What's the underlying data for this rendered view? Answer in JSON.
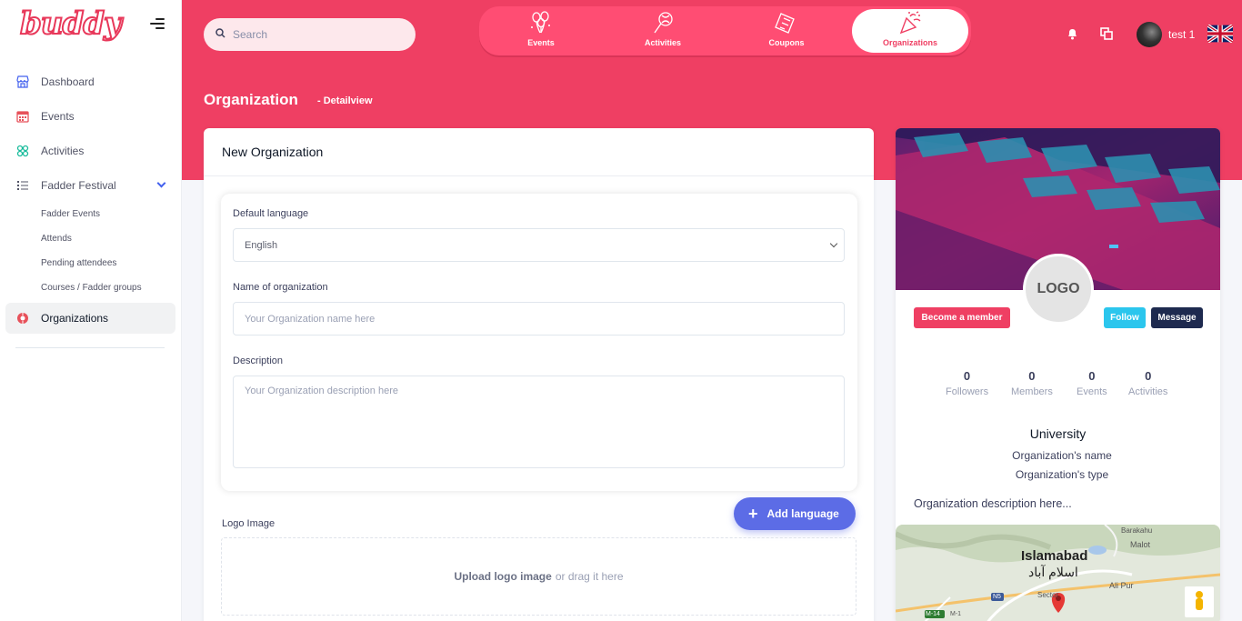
{
  "app": {
    "logo_text": "buddy"
  },
  "sidebar": {
    "items": [
      {
        "label": "Dashboard",
        "icon": "store-icon"
      },
      {
        "label": "Events",
        "icon": "calendar-icon"
      },
      {
        "label": "Activities",
        "icon": "activities-icon"
      },
      {
        "label": "Fadder Festival",
        "icon": "list-icon"
      },
      {
        "label": "Organizations",
        "icon": "organization-icon"
      }
    ],
    "subitems": [
      "Fadder Events",
      "Attends",
      "Pending attendees",
      "Courses / Fadder groups"
    ]
  },
  "header": {
    "search_placeholder": "Search",
    "tabs": [
      {
        "label": "Events",
        "icon": "balloons-icon"
      },
      {
        "label": "Activities",
        "icon": "lollipop-icon"
      },
      {
        "label": "Coupons",
        "icon": "ticket-icon"
      },
      {
        "label": "Organizations",
        "icon": "party-popper-icon",
        "active": true
      }
    ],
    "user_name": "test 1",
    "language_flag": "uk-flag-icon"
  },
  "page": {
    "title": "Organization",
    "breadcrumb": "- Detailview"
  },
  "form": {
    "card_title": "New Organization",
    "default_language_label": "Default language",
    "default_language_value": "English",
    "name_label": "Name of organization",
    "name_placeholder": "Your Organization name here",
    "description_label": "Description",
    "description_placeholder": "Your Organization description here",
    "add_language_label": "Add language",
    "logo_image_label": "Logo Image",
    "upload_bold": "Upload logo image",
    "upload_rest": "or drag it here"
  },
  "profile": {
    "logo_text": "LOGO",
    "become_member_label": "Become a member",
    "follow_label": "Follow",
    "message_label": "Message",
    "stats": [
      {
        "value": "0",
        "caption": "Followers"
      },
      {
        "value": "0",
        "caption": "Members"
      },
      {
        "value": "0",
        "caption": "Events"
      },
      {
        "value": "0",
        "caption": "Activities"
      }
    ],
    "org_category": "University",
    "org_name": "Organization's name",
    "org_type": "Organization's type",
    "org_description": "Organization description here..."
  },
  "map": {
    "city": "Islamabad",
    "city_local": "اسلام آباد",
    "labels": [
      "Malot",
      "Ali Pur",
      "N5",
      "M-14",
      "M-1",
      "Barakahu",
      "Sector"
    ]
  },
  "colors": {
    "brand": "#ef3f63",
    "accent": "#5c6ce6",
    "follow": "#2bc6ed",
    "message": "#1e2a4f"
  }
}
